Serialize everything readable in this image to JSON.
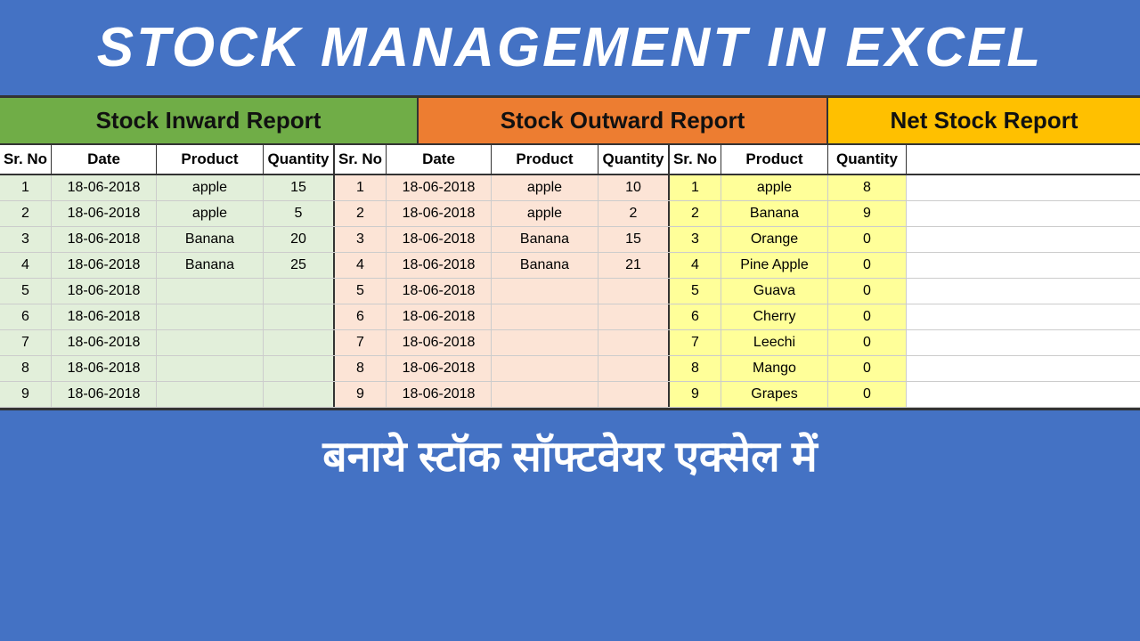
{
  "title": "STOCK MANAGEMENT IN EXCEL",
  "bottom_text": "बनाये स्टॉक सॉफ्टवेयर एक्सेल में",
  "sections": {
    "inward": {
      "label": "Stock Inward Report",
      "cols": [
        "Sr. No",
        "Date",
        "Product",
        "Quantity"
      ]
    },
    "outward": {
      "label": "Stock Outward Report",
      "cols": [
        "Sr. No",
        "Date",
        "Product",
        "Quantity"
      ]
    },
    "net": {
      "label": "Net Stock Report",
      "cols": [
        "Sr. No",
        "Product",
        "Quantity"
      ]
    }
  },
  "rows": [
    {
      "iw_srno": "1",
      "iw_date": "18-06-2018",
      "iw_product": "apple",
      "iw_qty": "15",
      "ow_srno": "1",
      "ow_date": "18-06-2018",
      "ow_product": "apple",
      "ow_qty": "10",
      "net_srno": "1",
      "net_product": "apple",
      "net_qty": "8"
    },
    {
      "iw_srno": "2",
      "iw_date": "18-06-2018",
      "iw_product": "apple",
      "iw_qty": "5",
      "ow_srno": "2",
      "ow_date": "18-06-2018",
      "ow_product": "apple",
      "ow_qty": "2",
      "net_srno": "2",
      "net_product": "Banana",
      "net_qty": "9"
    },
    {
      "iw_srno": "3",
      "iw_date": "18-06-2018",
      "iw_product": "Banana",
      "iw_qty": "20",
      "ow_srno": "3",
      "ow_date": "18-06-2018",
      "ow_product": "Banana",
      "ow_qty": "15",
      "net_srno": "3",
      "net_product": "Orange",
      "net_qty": "0"
    },
    {
      "iw_srno": "4",
      "iw_date": "18-06-2018",
      "iw_product": "Banana",
      "iw_qty": "25",
      "ow_srno": "4",
      "ow_date": "18-06-2018",
      "ow_product": "Banana",
      "ow_qty": "21",
      "net_srno": "4",
      "net_product": "Pine Apple",
      "net_qty": "0"
    },
    {
      "iw_srno": "5",
      "iw_date": "18-06-2018",
      "iw_product": "",
      "iw_qty": "",
      "ow_srno": "5",
      "ow_date": "18-06-2018",
      "ow_product": "",
      "ow_qty": "",
      "net_srno": "5",
      "net_product": "Guava",
      "net_qty": "0"
    },
    {
      "iw_srno": "6",
      "iw_date": "18-06-2018",
      "iw_product": "",
      "iw_qty": "",
      "ow_srno": "6",
      "ow_date": "18-06-2018",
      "ow_product": "",
      "ow_qty": "",
      "net_srno": "6",
      "net_product": "Cherry",
      "net_qty": "0"
    },
    {
      "iw_srno": "7",
      "iw_date": "18-06-2018",
      "iw_product": "",
      "iw_qty": "",
      "ow_srno": "7",
      "ow_date": "18-06-2018",
      "ow_product": "",
      "ow_qty": "",
      "net_srno": "7",
      "net_product": "Leechi",
      "net_qty": "0"
    },
    {
      "iw_srno": "8",
      "iw_date": "18-06-2018",
      "iw_product": "",
      "iw_qty": "",
      "ow_srno": "8",
      "ow_date": "18-06-2018",
      "ow_product": "",
      "ow_qty": "",
      "net_srno": "8",
      "net_product": "Mango",
      "net_qty": "0"
    },
    {
      "iw_srno": "9",
      "iw_date": "18-06-2018",
      "iw_product": "",
      "iw_qty": "",
      "ow_srno": "9",
      "ow_date": "18-06-2018",
      "ow_product": "",
      "ow_qty": "",
      "net_srno": "9",
      "net_product": "Grapes",
      "net_qty": "0"
    }
  ]
}
